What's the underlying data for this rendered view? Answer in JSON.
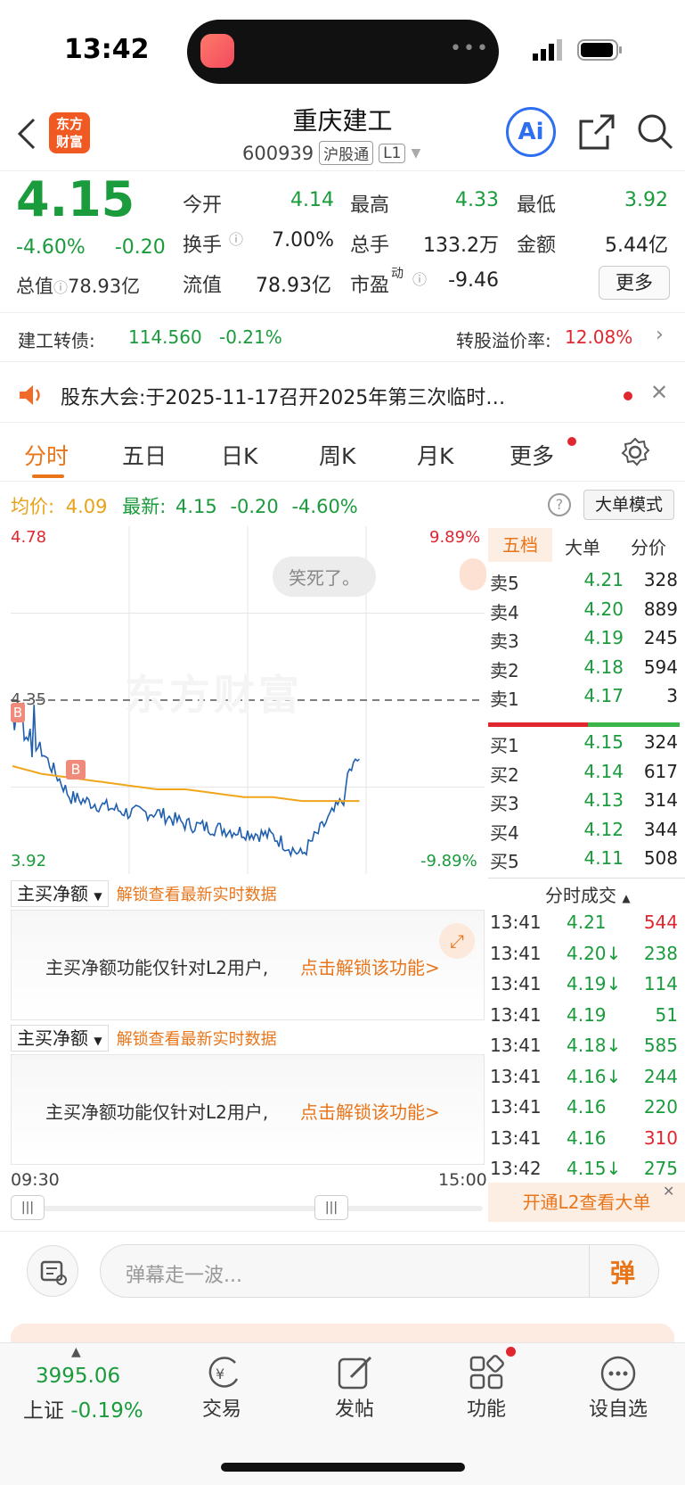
{
  "status": {
    "time": "13:42"
  },
  "header": {
    "logo": "东方财富",
    "title": "重庆建工",
    "code": "600939",
    "tag1": "沪股通",
    "tag2": "L1",
    "ai": "Ai"
  },
  "quote": {
    "price": "4.15",
    "pct": "-4.60%",
    "chg": "-0.20",
    "total_label": "总值",
    "total_value": "78.93亿",
    "stats": [
      {
        "label": "今开",
        "value": "4.14",
        "color": "green"
      },
      {
        "label": "最高",
        "value": "4.33",
        "color": "green"
      },
      {
        "label": "最低",
        "value": "3.92",
        "color": "green"
      },
      {
        "label": "换手",
        "value": "7.00%",
        "color": "black"
      },
      {
        "label": "总手",
        "value": "133.2万",
        "color": "black"
      },
      {
        "label": "金额",
        "value": "5.44亿",
        "color": "black"
      },
      {
        "label": "流值",
        "value": "78.93亿",
        "color": "black"
      },
      {
        "label": "市盈",
        "value": "-9.46",
        "color": "black"
      }
    ],
    "pe_sup": "动",
    "more": "更多"
  },
  "bond": {
    "label": "建工转债:",
    "price": "114.560",
    "pct": "-0.21%",
    "premium_label": "转股溢价率:",
    "premium_value": "12.08%"
  },
  "notice": {
    "text": "股东大会:于2025-11-17召开2025年第三次临时…"
  },
  "tabs": [
    "分时",
    "五日",
    "日K",
    "周K",
    "月K",
    "更多"
  ],
  "avg": {
    "avg_label": "均价:",
    "avg_value": "4.09",
    "latest_label": "最新:",
    "latest_value": "4.15",
    "chg": "-0.20",
    "pct": "-4.60%",
    "mode": "大单模式"
  },
  "chart": {
    "y_top": "4.78",
    "y_bottom": "3.92",
    "pct_top": "9.89%",
    "pct_bottom": "-9.89%",
    "ref": "4.35",
    "watermark": "东方财富",
    "bubble": "笑死了。",
    "marker": "B",
    "x_start": "09:30",
    "x_end": "15:00"
  },
  "chart_data": {
    "type": "line",
    "x": [
      "09:30",
      "09:45",
      "10:00",
      "10:15",
      "10:30",
      "10:45",
      "11:00",
      "11:15",
      "11:30",
      "13:00",
      "13:15",
      "13:30",
      "13:42"
    ],
    "series": [
      {
        "name": "price",
        "values": [
          4.3,
          4.22,
          4.1,
          4.08,
          4.06,
          4.06,
          4.03,
          4.02,
          4.01,
          4.0,
          3.95,
          4.05,
          4.15
        ]
      },
      {
        "name": "avg",
        "values": [
          4.18,
          4.16,
          4.15,
          4.14,
          4.13,
          4.12,
          4.12,
          4.11,
          4.1,
          4.1,
          4.09,
          4.09,
          4.09
        ]
      }
    ],
    "ylim": [
      3.92,
      4.78
    ]
  },
  "orderbook": {
    "tabs": [
      "五档",
      "大单",
      "分价"
    ],
    "asks": [
      {
        "label": "卖5",
        "price": "4.21",
        "vol": "328"
      },
      {
        "label": "卖4",
        "price": "4.20",
        "vol": "889"
      },
      {
        "label": "卖3",
        "price": "4.19",
        "vol": "245"
      },
      {
        "label": "卖2",
        "price": "4.18",
        "vol": "594"
      },
      {
        "label": "卖1",
        "price": "4.17",
        "vol": "3"
      }
    ],
    "bids": [
      {
        "label": "买1",
        "price": "4.15",
        "vol": "324"
      },
      {
        "label": "买2",
        "price": "4.14",
        "vol": "617"
      },
      {
        "label": "买3",
        "price": "4.13",
        "vol": "314"
      },
      {
        "label": "买4",
        "price": "4.12",
        "vol": "344"
      },
      {
        "label": "买5",
        "price": "4.11",
        "vol": "508"
      }
    ]
  },
  "trades": {
    "title": "分时成交",
    "rows": [
      {
        "t": "13:41",
        "p": "4.21",
        "v": "544",
        "pc": "green",
        "vc": "red"
      },
      {
        "t": "13:41",
        "p": "4.20↓",
        "v": "238",
        "pc": "green",
        "vc": "green"
      },
      {
        "t": "13:41",
        "p": "4.19↓",
        "v": "114",
        "pc": "green",
        "vc": "green"
      },
      {
        "t": "13:41",
        "p": "4.19",
        "v": "51",
        "pc": "green",
        "vc": "green"
      },
      {
        "t": "13:41",
        "p": "4.18↓",
        "v": "585",
        "pc": "green",
        "vc": "green"
      },
      {
        "t": "13:41",
        "p": "4.16↓",
        "v": "244",
        "pc": "green",
        "vc": "green"
      },
      {
        "t": "13:41",
        "p": "4.16",
        "v": "220",
        "pc": "green",
        "vc": "green"
      },
      {
        "t": "13:41",
        "p": "4.16",
        "v": "310",
        "pc": "green",
        "vc": "red"
      },
      {
        "t": "13:42",
        "p": "4.15↓",
        "v": "275",
        "pc": "green",
        "vc": "green"
      }
    ],
    "l2": "开通L2查看大单"
  },
  "l2_panels": [
    {
      "dropdown": "主买净额",
      "unlock": "解锁查看最新实时数据",
      "msg": "主买净额功能仅针对L2用户,",
      "link": "点击解锁该功能>"
    },
    {
      "dropdown": "主买净额",
      "unlock": "解锁查看最新实时数据",
      "msg": "主买净额功能仅针对L2用户,",
      "link": "点击解锁该功能>"
    }
  ],
  "danmu": {
    "placeholder": "弹幕走一波...",
    "btn": "弹"
  },
  "nav": {
    "index_value": "3995.06",
    "index_name": "上证",
    "index_pct": "-0.19%",
    "items": [
      "交易",
      "发帖",
      "功能",
      "设自选"
    ]
  }
}
